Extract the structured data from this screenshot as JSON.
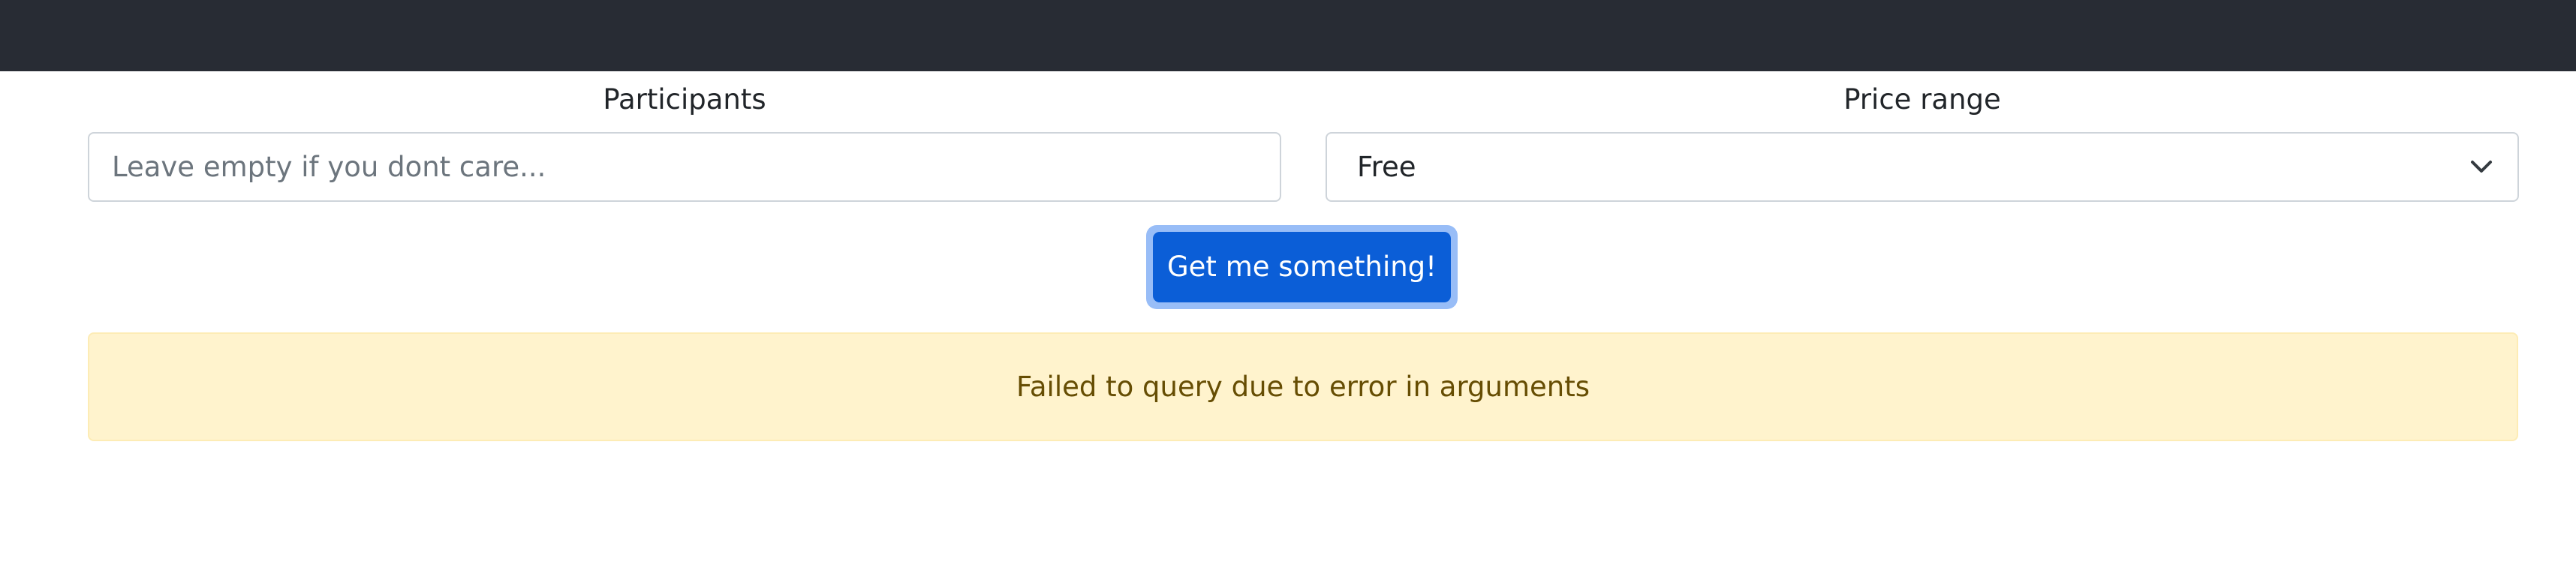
{
  "form": {
    "participants": {
      "label": "Participants",
      "value": "",
      "placeholder": "Leave empty if you dont care..."
    },
    "price_range": {
      "label": "Price range",
      "selected": "Free"
    },
    "submit_label": "Get me something!"
  },
  "alert": {
    "message": "Failed to query due to error in arguments"
  },
  "colors": {
    "navbar": "#282c34",
    "primary": "#0b5ed7",
    "alert_bg": "#fff3cd",
    "alert_text": "#664d03"
  },
  "icons": {
    "select_caret": "chevron-down-icon"
  }
}
